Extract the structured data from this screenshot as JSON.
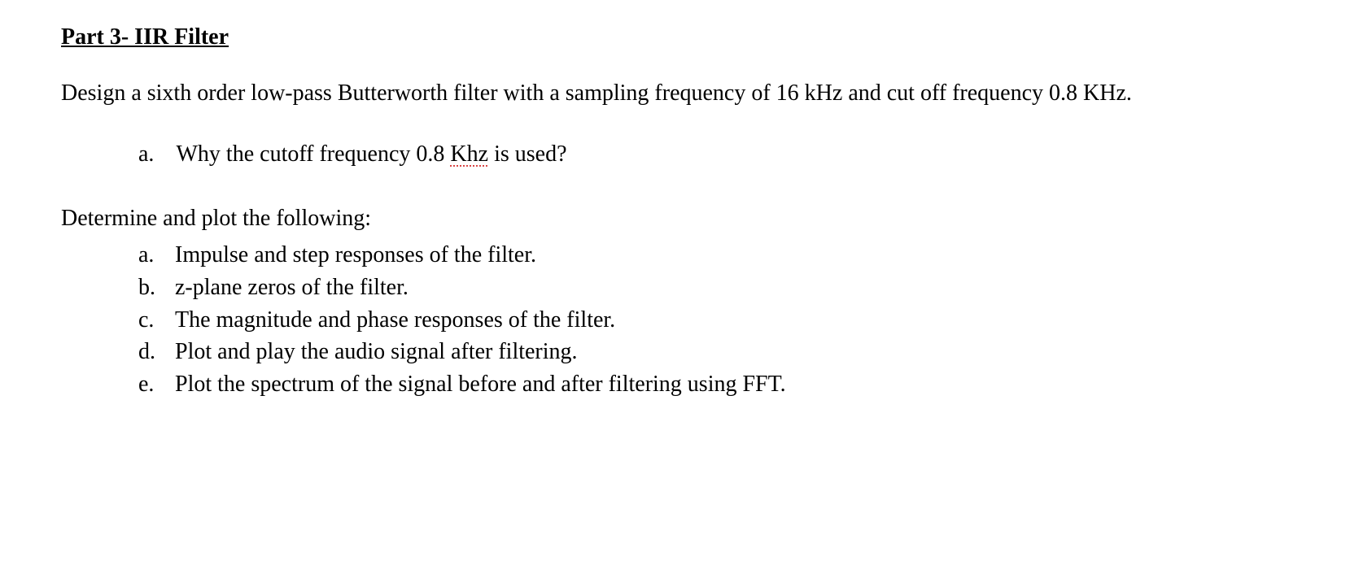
{
  "title": "Part 3- IIR Filter",
  "intro": "Design a sixth order low-pass Butterworth filter with a sampling frequency of 16 kHz and cut off frequency 0.8 KHz.",
  "question": {
    "marker": "a.",
    "text_before": "Why the cutoff frequency 0.8 ",
    "spellcheck_word": "Khz",
    "text_after": " is used?"
  },
  "subheading": "Determine and plot the following:",
  "items": [
    {
      "marker": "a.",
      "text": "Impulse and step responses of the filter."
    },
    {
      "marker": "b.",
      "text": "z-plane zeros of the filter."
    },
    {
      "marker": "c.",
      "text": "The magnitude and phase responses of the filter."
    },
    {
      "marker": "d.",
      "text": "Plot and play the audio signal after filtering."
    },
    {
      "marker": "e.",
      "text": "Plot the spectrum of the signal before and after filtering using FFT."
    }
  ]
}
